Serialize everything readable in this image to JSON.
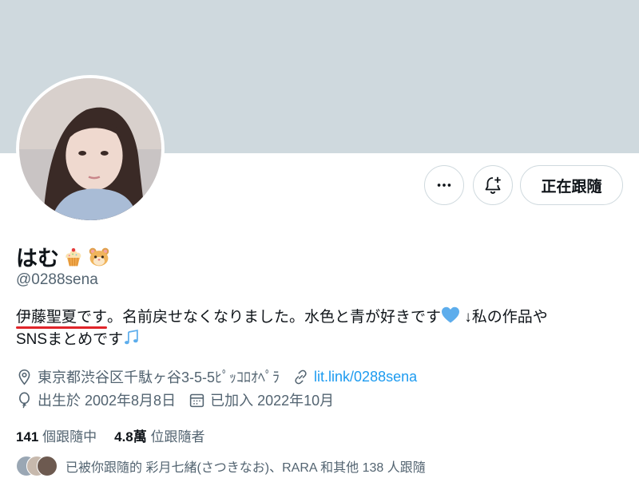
{
  "profile": {
    "display_name": "はむ",
    "handle": "@0288sena",
    "bio": {
      "highlight": "伊藤聖夏です",
      "line1_rest": "。名前戻せなくなりました。水色と青が好きです",
      "line1_tail": " ↓私の作品や",
      "line2": "SNSまとめです"
    },
    "location": "東京都渋谷区千駄ヶ谷3-5-5ﾋﾟｯｺﾛｵﾍﾟﾗ",
    "website": "lit.link/0288sena",
    "birthday": "出生於 2002年8月8日",
    "joined": "已加入 2022年10月"
  },
  "actions": {
    "follow_label": "正在跟隨"
  },
  "stats": {
    "following_count": "141",
    "following_label": "個跟隨中",
    "followers_count": "4.8萬",
    "followers_label": "位跟隨者"
  },
  "followed_by": "已被你跟隨的 彩月七緒(さつきなお)、RARA 和其他 138 人跟隨",
  "icons": [
    "more-icon",
    "bell-plus-icon",
    "location-icon",
    "link-icon",
    "balloon-icon",
    "calendar-icon",
    "cupcake-emoji",
    "hamster-emoji",
    "blue-heart-emoji",
    "music-notes-emoji"
  ],
  "colors": {
    "banner": "#cfd9de",
    "link": "#1d9bf0",
    "secondary_text": "#536471",
    "underline": "#e0242a"
  }
}
